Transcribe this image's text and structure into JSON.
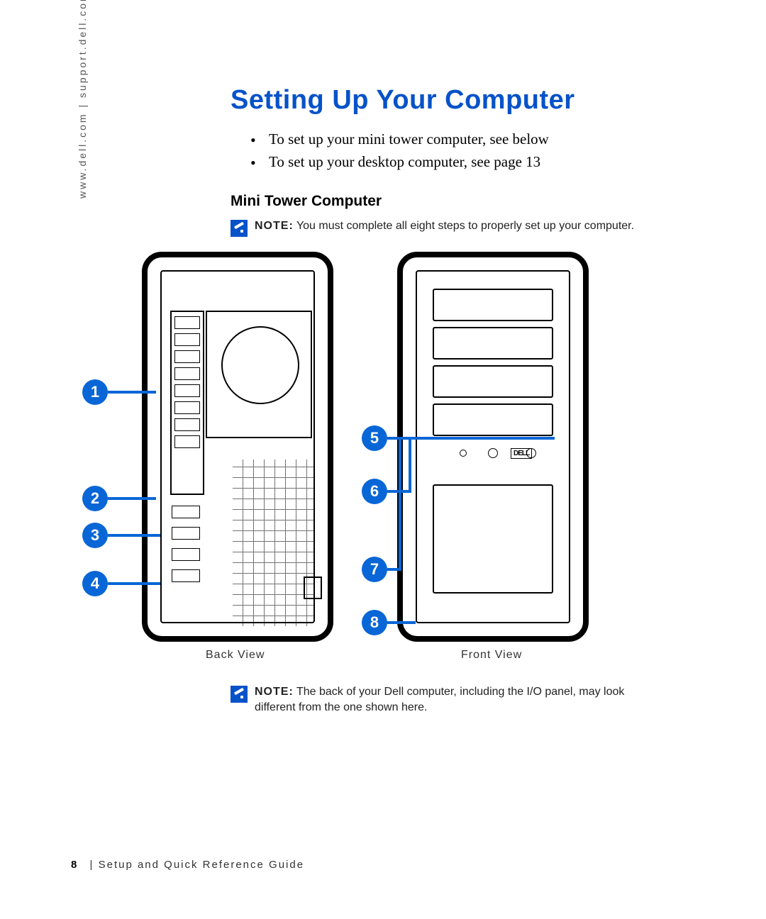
{
  "side_url": "www.dell.com | support.dell.com",
  "title": "Setting Up Your Computer",
  "bullets": [
    "To set up your mini tower computer, see below",
    "To set up your desktop computer, see page 13"
  ],
  "subhead": "Mini Tower Computer",
  "note_top": {
    "label": "NOTE:",
    "text": "You must complete all eight steps to properly set up your computer."
  },
  "callouts": [
    "1",
    "2",
    "3",
    "4",
    "5",
    "6",
    "7",
    "8"
  ],
  "view_labels": {
    "back": "Back View",
    "front": "Front View"
  },
  "note_bottom": {
    "label": "NOTE:",
    "text": "The back of your Dell computer, including the I/O panel, may look different from the one shown here."
  },
  "footer": {
    "page_number": "8",
    "separator": "|",
    "title": "Setup and Quick Reference Guide"
  },
  "front_logo": "DELL",
  "colors": {
    "accent": "#0652c9",
    "callout": "#0866d6"
  }
}
